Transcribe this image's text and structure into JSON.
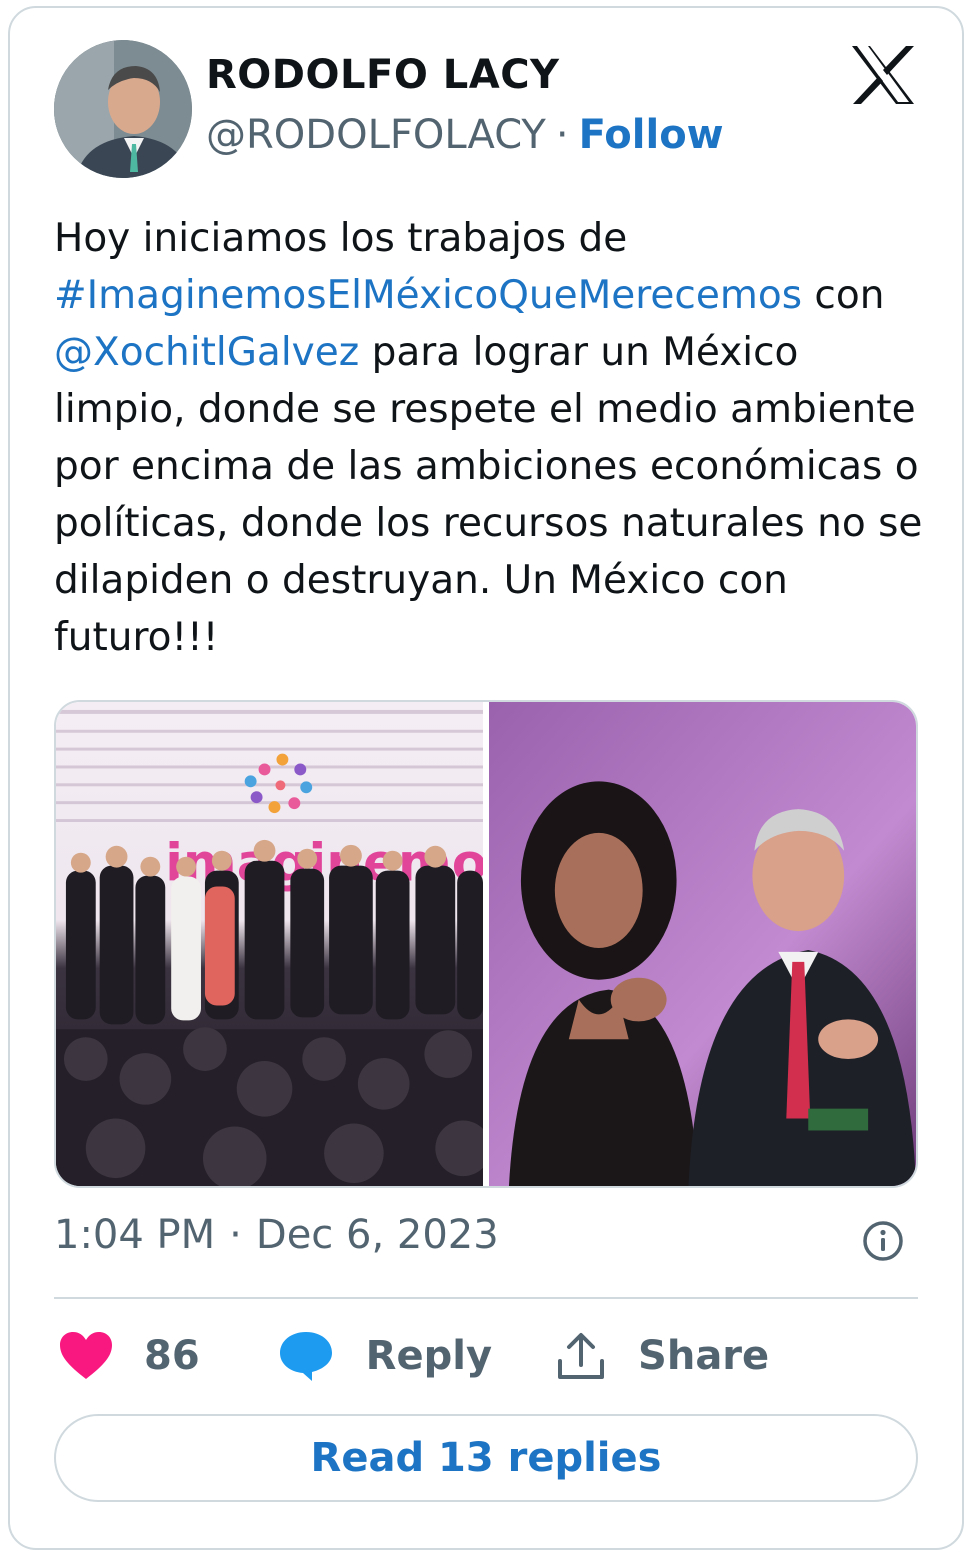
{
  "author": {
    "name": "RODOLFO LACY",
    "handle": "@RODOLFOLACY",
    "separator": "·",
    "follow_label": "Follow"
  },
  "logo_icon": "x-logo-icon",
  "tweet": {
    "text_before": "Hoy iniciamos los trabajos de ",
    "hashtag": "#ImaginemosElMéxicoQueMerecemos",
    "text_mid": " con ",
    "mention": "@XochitlGalvez",
    "text_after": " para lograr un México limpio, donde se respete el medio ambiente por encima de las ambiciones económicas o políticas, donde los recursos naturales no se dilapiden o destruyan. Un México con futuro!!!"
  },
  "media": {
    "image1_stage_text": "imaginemos"
  },
  "meta": {
    "time": "1:04 PM",
    "separator": "·",
    "date": "Dec 6, 2023"
  },
  "actions": {
    "like_count": "86",
    "reply_label": "Reply",
    "share_label": "Share"
  },
  "read_replies_label": "Read 13 replies",
  "colors": {
    "link": "#1d74c4",
    "like": "#f91880",
    "reply_bubble": "#1d9bf0",
    "border": "#cfd9de",
    "secondary_text": "#536471"
  }
}
